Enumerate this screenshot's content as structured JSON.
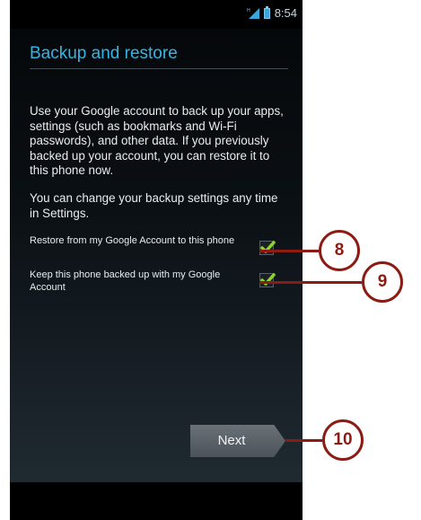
{
  "status_bar": {
    "time": "8:54",
    "icons": [
      "signal-icon",
      "battery-icon"
    ]
  },
  "screen": {
    "title": "Backup and restore",
    "description": "Use your Google account to back up your apps, settings (such as bookmarks and Wi-Fi passwords), and other data. If you previously backed up your account, you can restore it to this phone now.",
    "note": "You can change your backup settings any time in Settings.",
    "options": [
      {
        "label": "Restore from my Google Account to this phone",
        "checked": true
      },
      {
        "label": "Keep this phone backed up with my Google Account",
        "checked": true
      }
    ],
    "next_label": "Next"
  },
  "callouts": [
    "8",
    "9",
    "10"
  ],
  "colors": {
    "title": "#34b5e5",
    "check": "#8fd42b",
    "callout": "#8c1c13",
    "button": "#5a6268"
  }
}
